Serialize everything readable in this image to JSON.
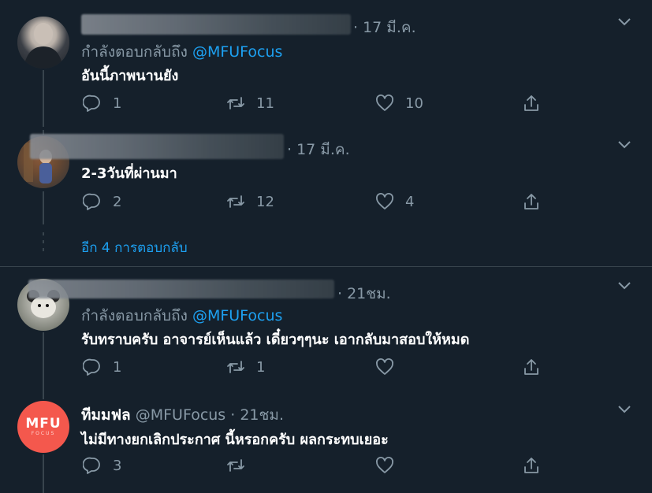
{
  "tweets": [
    {
      "time": "· 17 มี.ค.",
      "reply_to_prefix": "กำลังตอบกลับถึง",
      "reply_to_handle": "@MFUFocus",
      "text": "อันนี้ภาพนานยัง",
      "reply_count": "1",
      "retweet_count": "11",
      "like_count": "10"
    },
    {
      "time": "· 17 มี.ค.",
      "text": "2-3วันที่ผ่านมา",
      "reply_count": "2",
      "retweet_count": "12",
      "like_count": "4"
    },
    {
      "time": "· 21ชม.",
      "reply_to_prefix": "กำลังตอบกลับถึง",
      "reply_to_handle": "@MFUFocus",
      "text": "รับทราบครับ อาจารย์เห็นแล้ว เดี๋ยวๆๆนะ เอากลับมาสอบให้หมด",
      "reply_count": "1",
      "retweet_count": "1",
      "like_count": ""
    },
    {
      "name": "ทีมมฟล",
      "handle": "@MFUFocus",
      "time": "· 21ชม.",
      "text": "ไม่มีทางยกเลิกประกาศ นี้หรอกครับ ผลกระทบเยอะ",
      "reply_count": "3",
      "retweet_count": "",
      "like_count": ""
    }
  ],
  "more_replies": "อีก 4 การตอบกลับ",
  "mfu_logo": {
    "main": "MFU",
    "sub": "FOCUS",
    "color": "#f4584d"
  },
  "colors": {
    "background": "#15202b",
    "secondary": "#8899a6",
    "link": "#1da1f2"
  }
}
